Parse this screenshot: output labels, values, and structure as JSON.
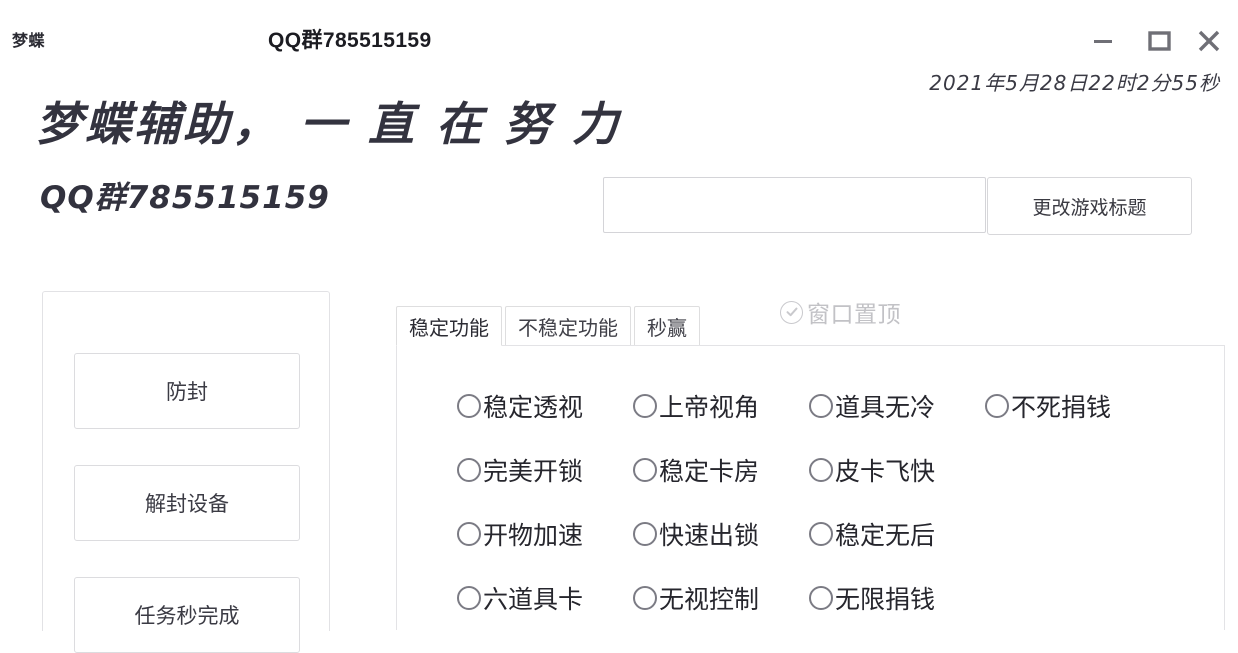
{
  "window": {
    "app_title": "梦蝶",
    "center_title": "QQ群785515159",
    "controls": {
      "minimize": "minimize-icon",
      "maximize": "maximize-icon",
      "close": "close-icon"
    }
  },
  "clock": {
    "text": "2021年5月28日22时2分55秒"
  },
  "banner": {
    "headline": "梦蝶辅助， 一 直 在 努 力",
    "subline": "QQ群785515159"
  },
  "game_title_bar": {
    "input_value": "",
    "input_placeholder": "",
    "button_label": "更改游戏标题"
  },
  "sidebar": {
    "buttons": [
      {
        "label": "防封"
      },
      {
        "label": "解封设备"
      },
      {
        "label": "任务秒完成"
      }
    ]
  },
  "tabs": {
    "items": [
      {
        "label": "稳定功能",
        "active": true
      },
      {
        "label": "不稳定功能",
        "active": false
      },
      {
        "label": "秒赢",
        "active": false
      }
    ]
  },
  "always_on_top": {
    "label": "窗口置顶",
    "checked": true,
    "disabled": true,
    "icon": "check-circle-icon"
  },
  "options": {
    "rows": [
      [
        {
          "label": "稳定透视",
          "checked": false
        },
        {
          "label": "上帝视角",
          "checked": false
        },
        {
          "label": "道具无冷",
          "checked": false
        },
        {
          "label": "不死捐钱",
          "checked": false
        }
      ],
      [
        {
          "label": "完美开锁",
          "checked": false
        },
        {
          "label": "稳定卡房",
          "checked": false
        },
        {
          "label": "皮卡飞快",
          "checked": false
        }
      ],
      [
        {
          "label": "开物加速",
          "checked": false
        },
        {
          "label": "快速出锁",
          "checked": false
        },
        {
          "label": "稳定无后",
          "checked": false
        }
      ],
      [
        {
          "label": "六道具卡",
          "checked": false
        },
        {
          "label": "无视控制",
          "checked": false
        },
        {
          "label": "无限捐钱",
          "checked": false
        }
      ]
    ]
  },
  "colors": {
    "text_primary": "#26262d",
    "text_muted": "#c2c2c6",
    "border": "#e0e0e4",
    "background": "#ffffff"
  }
}
